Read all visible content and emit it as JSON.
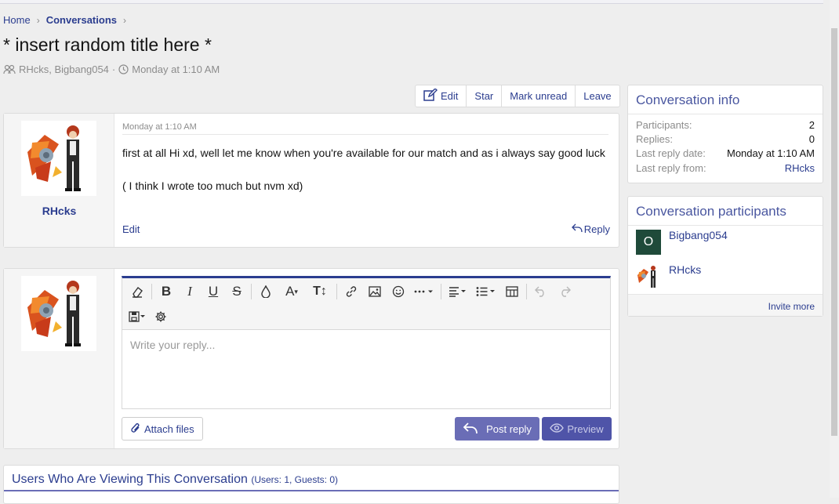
{
  "breadcrumb": {
    "home": "Home",
    "conversations": "Conversations"
  },
  "title": "* insert random title here *",
  "meta": {
    "participants": "RHcks, Bigbang054",
    "separator": "·",
    "date": "Monday at 1:10 AM"
  },
  "actions": {
    "edit": "Edit",
    "star": "Star",
    "mark_unread": "Mark unread",
    "leave": "Leave"
  },
  "message": {
    "author": "RHcks",
    "date": "Monday at 1:10 AM",
    "body_line1": "first at all Hi xd, well let me know when you're available for our match and as i always say good luck",
    "body_line2": "( I think I wrote too much but nvm xd)",
    "edit": "Edit",
    "reply": "Reply"
  },
  "reply_form": {
    "placeholder": "Write your reply...",
    "attach": "Attach files",
    "post": "Post reply",
    "preview": "Preview"
  },
  "viewing": {
    "title": "Users Who Are Viewing This Conversation",
    "counts": "(Users: 1, Guests: 0)"
  },
  "conversation_info": {
    "title": "Conversation info",
    "rows": [
      {
        "key": "Participants:",
        "value": "2"
      },
      {
        "key": "Replies:",
        "value": "0"
      },
      {
        "key": "Last reply date:",
        "value": "Monday at 1:10 AM"
      },
      {
        "key": "Last reply from:",
        "value": "RHcks"
      }
    ]
  },
  "participants": {
    "title": "Conversation participants",
    "items": [
      {
        "name": "Bigbang054",
        "initial": "O"
      },
      {
        "name": "RHcks"
      }
    ],
    "invite": "Invite more"
  },
  "colors": {
    "link": "#2b3d8f",
    "accent": "#4f54a8",
    "post_button": "#6a6db6",
    "letter_avatar": "#1f4a3a"
  }
}
